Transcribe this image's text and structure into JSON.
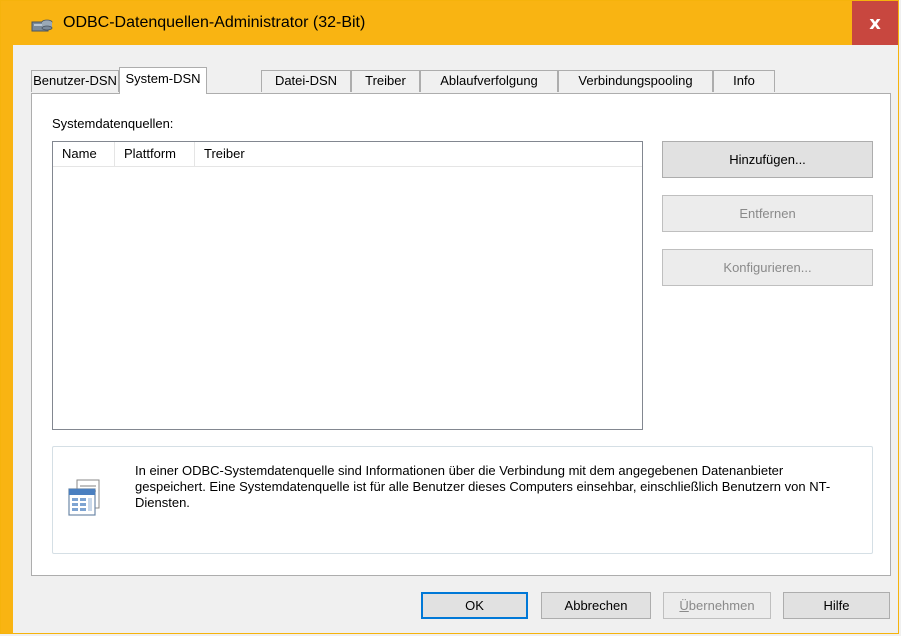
{
  "window": {
    "title": "ODBC-Datenquellen-Administrator (32-Bit)",
    "close_symbol": "x",
    "accent_color": "#f9b412",
    "close_color": "#c8473f"
  },
  "tabs": [
    {
      "label": "Benutzer-DSN",
      "active": false
    },
    {
      "label": "System-DSN",
      "active": true
    },
    {
      "label": "Datei-DSN",
      "active": false
    },
    {
      "label": "Treiber",
      "active": false
    },
    {
      "label": "Ablaufverfolgung",
      "active": false
    },
    {
      "label": "Verbindungspooling",
      "active": false
    },
    {
      "label": "Info",
      "active": false
    }
  ],
  "panel": {
    "list_label": "Systemdatenquellen:",
    "columns": [
      "Name",
      "Plattform",
      "Treiber"
    ],
    "rows": [],
    "buttons": {
      "add": "Hinzufügen...",
      "remove": "Entfernen",
      "configure": "Konfigurieren..."
    },
    "info_icon": "datasource-icon",
    "info_text": "In einer ODBC-Systemdatenquelle sind Informationen über die Verbindung mit dem angegebenen Datenanbieter gespeichert. Eine Systemdatenquelle ist für alle Benutzer dieses Computers einsehbar, einschließlich Benutzern von NT-Diensten."
  },
  "footer": {
    "ok": "OK",
    "cancel": "Abbrechen",
    "apply_underlined": "Ü",
    "apply_rest": "bernehmen",
    "help": "Hilfe"
  }
}
